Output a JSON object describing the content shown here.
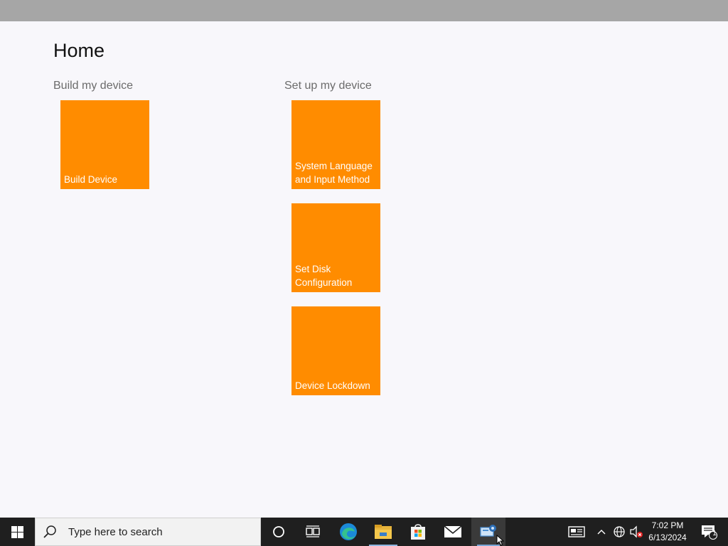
{
  "window": {
    "page_title": "Home"
  },
  "groups": [
    {
      "title": "Build my device",
      "tiles": [
        {
          "label_lines": [
            "Build Device"
          ]
        }
      ]
    },
    {
      "title": "Set up my device",
      "tiles": [
        {
          "label_lines": [
            "System Language",
            "and Input Method"
          ]
        },
        {
          "label_lines": [
            "Set Disk",
            "Configuration"
          ]
        },
        {
          "label_lines": [
            "Device Lockdown"
          ]
        }
      ]
    }
  ],
  "tile_color": "#ff8c00",
  "taskbar": {
    "search_placeholder": "Type here to search",
    "apps": [
      "cortana-icon",
      "task-view-icon",
      "edge-icon",
      "file-explorer-icon",
      "store-icon",
      "mail-icon",
      "configuration-designer-icon"
    ],
    "clock_time": "7:02 PM",
    "clock_date": "6/13/2024",
    "notification_count": "1"
  }
}
